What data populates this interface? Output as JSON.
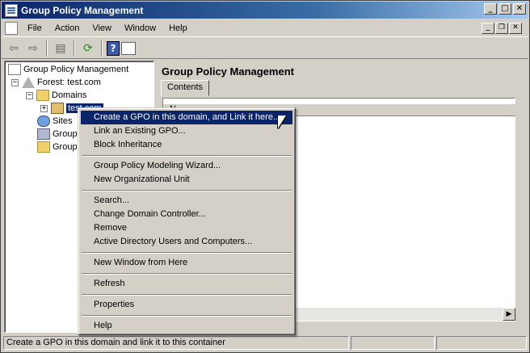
{
  "window": {
    "title": "Group Policy Management"
  },
  "menubar": {
    "items": [
      "File",
      "Action",
      "View",
      "Window",
      "Help"
    ]
  },
  "titlebar_buttons": {
    "minimize": "_",
    "maximize": "□",
    "close": "✕"
  },
  "mdi_buttons": {
    "minimize": "_",
    "restore": "❐",
    "close": "✕"
  },
  "toolbar": {
    "back": "⇦",
    "forward": "⇨",
    "show_hide": "▤",
    "refresh": "⟳",
    "help": "?",
    "properties": "▦"
  },
  "tree": {
    "root": "Group Policy Management",
    "forest": "Forest: test.com",
    "domains": "Domains",
    "domain_selected": "test.com",
    "sites": "Sites",
    "group_policy_modeling": "Group",
    "group_policy_results": "Group",
    "expand_symbol": "+",
    "collapse_symbol": "−"
  },
  "right_pane": {
    "title": "Group Policy Management",
    "tab_contents": "Contents",
    "column_header": "N"
  },
  "context_menu": {
    "items": [
      "Create a GPO in this domain, and Link it here...",
      "Link an Existing GPO...",
      "Block Inheritance",
      "Group Policy Modeling Wizard...",
      "New Organizational Unit",
      "Search...",
      "Change Domain Controller...",
      "Remove",
      "Active Directory Users and Computers...",
      "New Window from Here",
      "Refresh",
      "Properties",
      "Help"
    ]
  },
  "statusbar": {
    "text": "Create a GPO in this domain and link it to this container"
  },
  "scroll": {
    "right_arrow": "▶"
  }
}
